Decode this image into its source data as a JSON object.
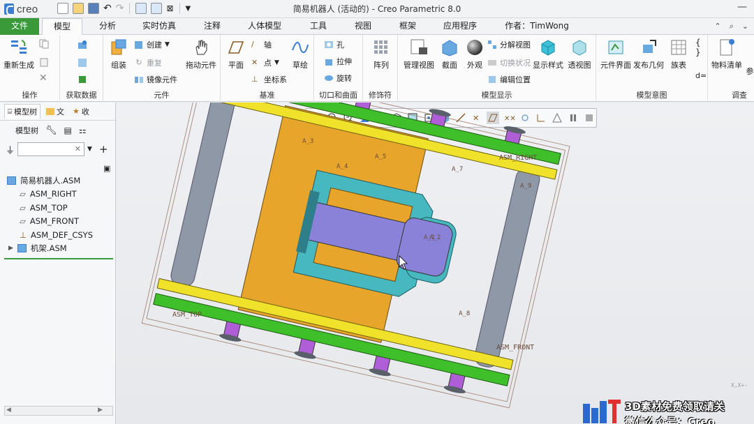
{
  "app": {
    "logo_text": "creo",
    "window_title": "简易机器人 (活动的) - Creo Parametric 8.0"
  },
  "tabs": [
    {
      "label": "文件"
    },
    {
      "label": "模型"
    },
    {
      "label": "分析"
    },
    {
      "label": "实时仿真"
    },
    {
      "label": "注释"
    },
    {
      "label": "人体模型"
    },
    {
      "label": "工具"
    },
    {
      "label": "视图"
    },
    {
      "label": "框架"
    },
    {
      "label": "应用程序"
    },
    {
      "label": "作者：TimWong"
    }
  ],
  "ribbon": {
    "operations": {
      "label": "操作",
      "regenerate": "重新生成"
    },
    "get_data": {
      "label": "获取数据"
    },
    "components": {
      "label": "元件",
      "assemble": "组装",
      "create": "创建",
      "repeat": "重复",
      "mirror": "镜像元件",
      "drag": "拖动元件"
    },
    "datum": {
      "label": "基准",
      "plane": "平面",
      "axis": "轴",
      "point": "点",
      "csys": "坐标系",
      "sketch": "草绘"
    },
    "cut_surface": {
      "label": "切口和曲面",
      "hole": "孔",
      "extrude": "拉伸",
      "revolve": "旋转"
    },
    "modifiers": {
      "label": "修饰符",
      "pattern": "阵列"
    },
    "model_display": {
      "label": "模型显示",
      "manage_views": "管理视图",
      "section": "截面",
      "appearance": "外观",
      "exploded_view": "分解视图",
      "toggle_status": "切换状况",
      "edit_position": "编辑位置",
      "display_style": "显示样式",
      "perspective": "透视图"
    },
    "model_intent": {
      "label": "模型意图",
      "component_interface": "元件界面",
      "publish_geometry": "发布几何",
      "family_table": "族表"
    },
    "investigate": {
      "label": "调查",
      "bom": "物料清单",
      "params": "参"
    }
  },
  "left_panel": {
    "tab_model_tree": "模型树",
    "tab_folder": "文",
    "tab_favorites": "收",
    "model_tree_label": "模型树",
    "filter_placeholder": "",
    "tree": [
      {
        "label": "简易机器人.ASM"
      },
      {
        "label": "ASM_RIGHT"
      },
      {
        "label": "ASM_TOP"
      },
      {
        "label": "ASM_FRONT"
      },
      {
        "label": "ASM_DEF_CSYS"
      },
      {
        "label": "机架.ASM"
      }
    ]
  },
  "viewport": {
    "datum_labels": {
      "asm_right": "ASM_RIGHT",
      "asm_top": "ASM_TOP",
      "asm_front": "ASM_FRONT"
    },
    "axis_labels": [
      "A_3",
      "A_4",
      "A_5",
      "A_7",
      "A_1",
      "A_2",
      "A_8",
      "A_9"
    ],
    "triad": "X,X+-"
  },
  "watermark": {
    "line1": "3D素材免费领取请关",
    "line2": "微信公众号：Creo"
  },
  "colors": {
    "file_tab": "#3a9a3a",
    "green_rail": "#3fbf2a",
    "yellow_rail": "#f0e22a",
    "orange_plate": "#e7a52c",
    "cyan_part": "#48b8c0",
    "purple_part": "#8a82d8",
    "magenta_part": "#b05ed8",
    "gray_cylinder": "#8e98a6"
  }
}
